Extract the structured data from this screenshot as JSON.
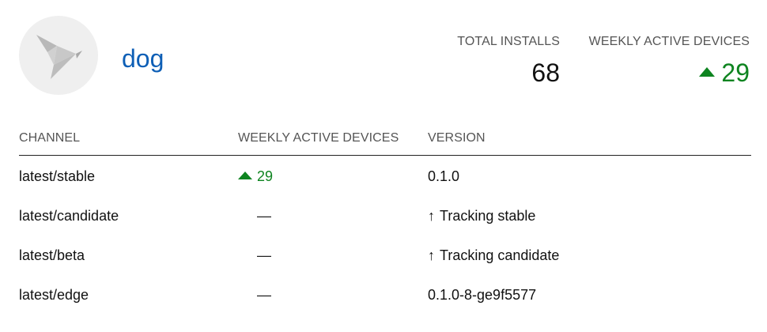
{
  "snap": {
    "name": "dog"
  },
  "metrics": {
    "total_installs_label": "TOTAL INSTALLS",
    "total_installs_value": "68",
    "weekly_active_label": "WEEKLY ACTIVE DEVICES",
    "weekly_active_value": "29"
  },
  "colors": {
    "link": "#0e5fb6",
    "positive": "#0e8420",
    "muted": "#555555",
    "avatar_bg": "#efefef"
  },
  "icons": {
    "avatar": "snap-bird-icon",
    "trend": "trend-up-icon",
    "tracking": "tracking-up-arrow-icon"
  },
  "table": {
    "headers": {
      "channel": "CHANNEL",
      "weekly": "WEEKLY ACTIVE DEVICES",
      "version": "VERSION"
    },
    "rows": [
      {
        "channel": "latest/stable",
        "weekly": "29",
        "weekly_trend": "up",
        "version": "0.1.0"
      },
      {
        "channel": "latest/candidate",
        "weekly": "—",
        "version_arrow": "↑",
        "version": "Tracking stable"
      },
      {
        "channel": "latest/beta",
        "weekly": "—",
        "version_arrow": "↑",
        "version": "Tracking candidate"
      },
      {
        "channel": "latest/edge",
        "weekly": "—",
        "version": "0.1.0-8-ge9f5577"
      }
    ]
  }
}
